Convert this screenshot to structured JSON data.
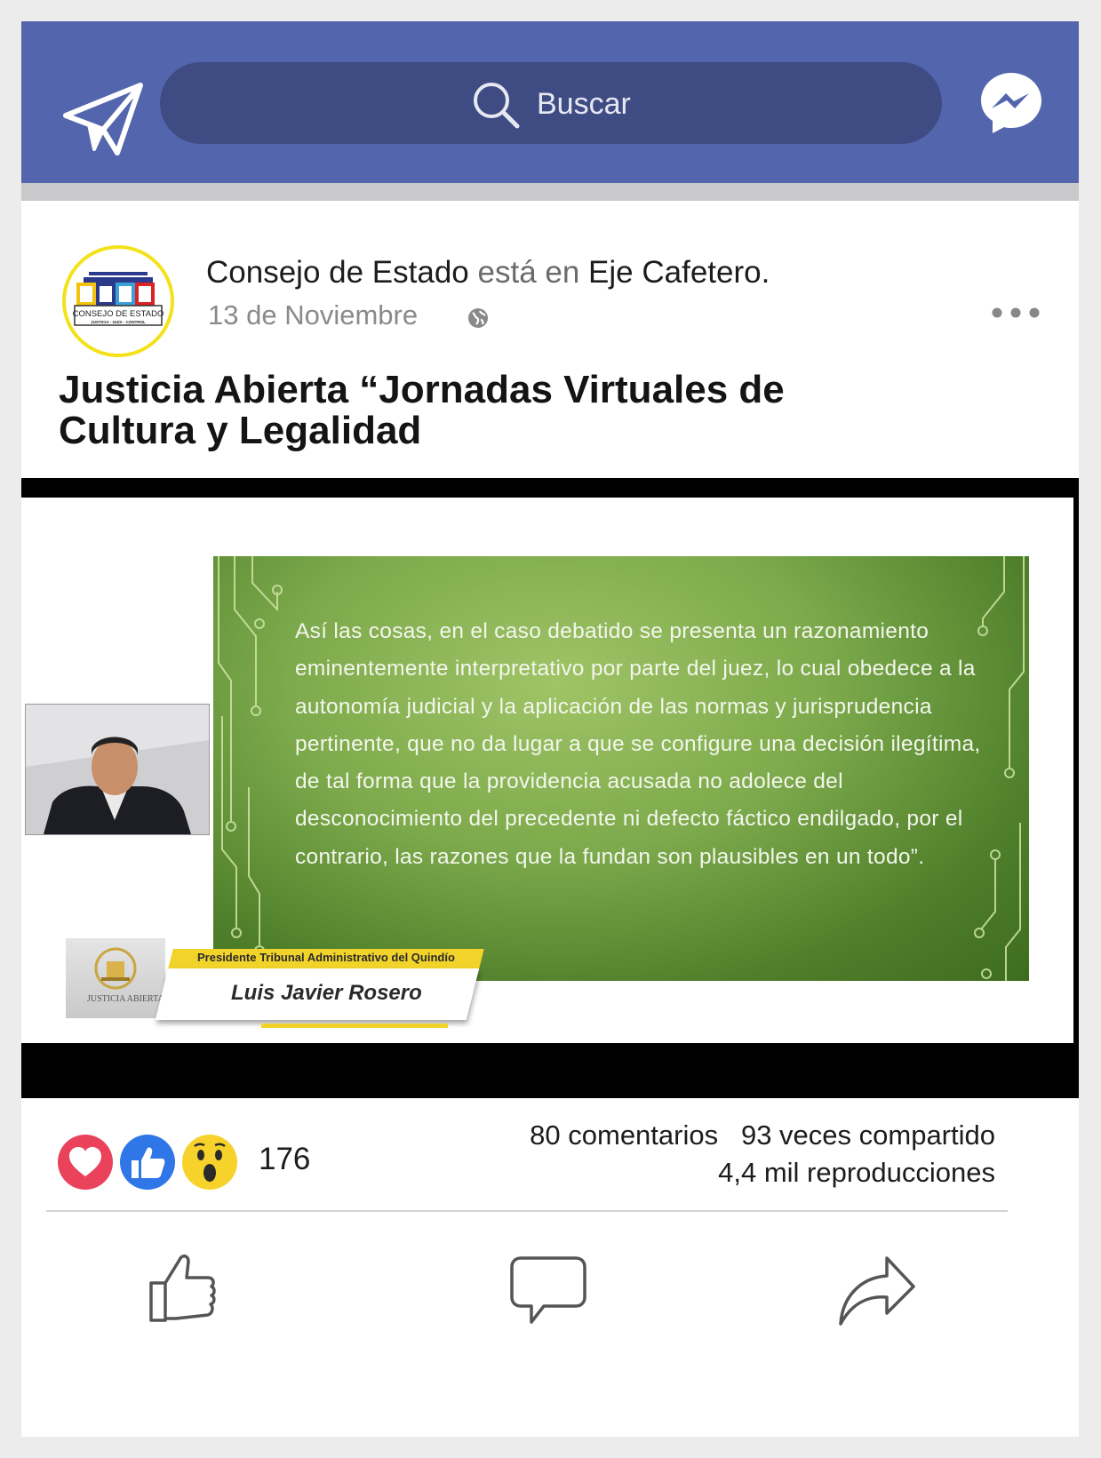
{
  "topbar": {
    "search_placeholder": "Buscar",
    "icons": [
      "send-icon",
      "search-icon",
      "messenger-icon"
    ],
    "color": "#5366ad"
  },
  "post": {
    "author": "Consejo de Estado",
    "connector": "está en",
    "location": "Eje Cafetero.",
    "date": "13 de Noviembre",
    "title": "Justicia Abierta “Jornadas Virtuales de Cultura y Legalidad",
    "avatar": {
      "logo_text": "CONSEJO DE ESTADO",
      "logo_subtext": "JUSTICIA - GUÍA - CONTROL"
    }
  },
  "video": {
    "slide_text": "Así las cosas, en el caso debatido se presenta un razonamiento eminentemente interpretativo por parte del juez, lo cual obedece a la autonomía judicial y la aplicación de las normas y jurisprudencia pertinente, que no da lugar a que se configure una decisión ilegítima, de tal forma que la providencia acusada no adolece del desconocimiento del precedente ni defecto fáctico endilgado, por el contrario, las razones que la fundan son plausibles en un todo”.",
    "speaker_role": "Presidente Tribunal Administrativo del Quindío",
    "speaker_name": "Luis Javier Rosero",
    "brand": "JUSTICIA ABIERTA"
  },
  "engagement": {
    "reaction_count": "176",
    "reactions": [
      "love-icon",
      "like-icon",
      "wow-icon"
    ],
    "comments": "80 comentarios",
    "shares": "93 veces compartido",
    "views": "4,4 mil  reproducciones"
  },
  "actions": [
    "like-action-icon",
    "comment-action-icon",
    "share-action-icon"
  ]
}
